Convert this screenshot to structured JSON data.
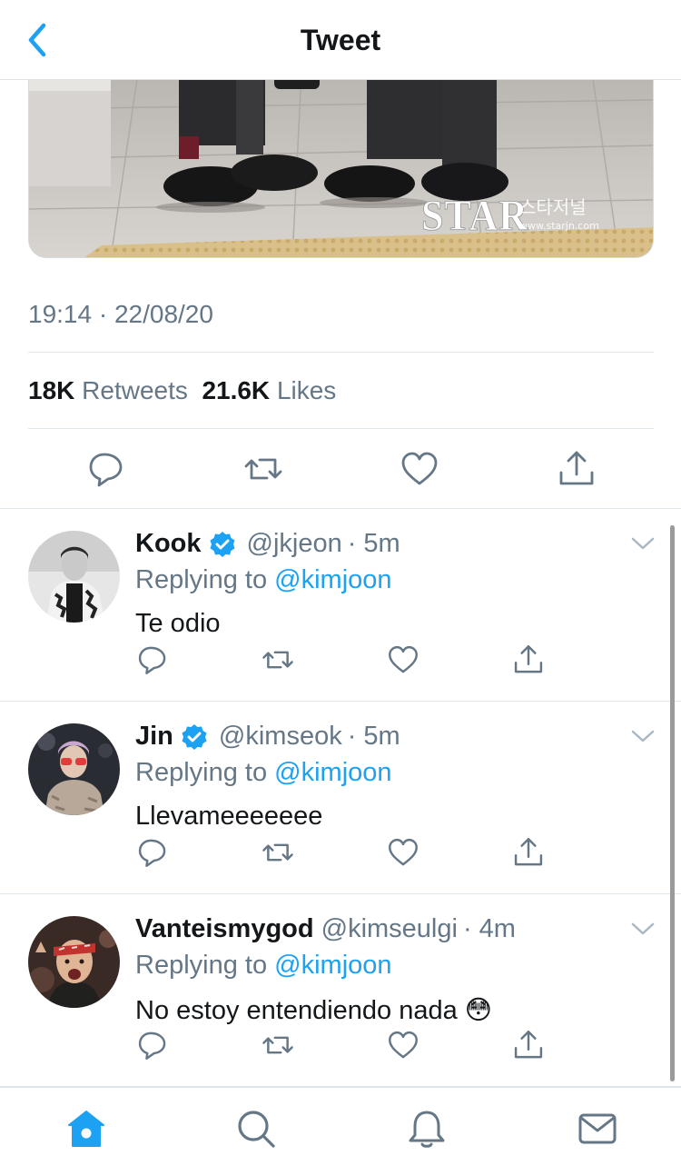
{
  "header": {
    "title": "Tweet",
    "back_icon": "chevron-left-icon"
  },
  "tweet": {
    "media_alt": "Photo of two people's legs in black trousers and dress shoes on pavement",
    "watermark": {
      "brand": "STAR",
      "korean": "스타저널",
      "url": "www.starjn.com"
    },
    "timestamp": "19:14 · 22/08/20",
    "retweets_count": "18K",
    "retweets_label": "Retweets",
    "likes_count": "21.6K",
    "likes_label": "Likes"
  },
  "replies": [
    {
      "name": "Kook",
      "verified": true,
      "handle": "@jkjeon",
      "time": "· 5m",
      "replying_prefix": "Replying to",
      "mention": "@kimjoon",
      "text": "Te odio"
    },
    {
      "name": "Jin",
      "verified": true,
      "handle": "@kimseok",
      "time": "· 5m",
      "replying_prefix": "Replying to",
      "mention": "@kimjoon",
      "text": "Llevameeeeeee"
    },
    {
      "name": "Vanteismygod",
      "verified": false,
      "handle": "@kimseulgi",
      "time": "· 4m",
      "replying_prefix": "Replying to",
      "mention": "@kimjoon",
      "text": "No estoy entendiendo nada 😳"
    }
  ],
  "colors": {
    "accent": "#1da1f2",
    "secondary_text": "#657786",
    "icon_gray": "#657786",
    "divider": "#e1e8ed"
  },
  "tabbar": {
    "items": [
      "home-icon",
      "search-icon",
      "notifications-icon",
      "messages-icon"
    ],
    "active": "home-icon"
  }
}
